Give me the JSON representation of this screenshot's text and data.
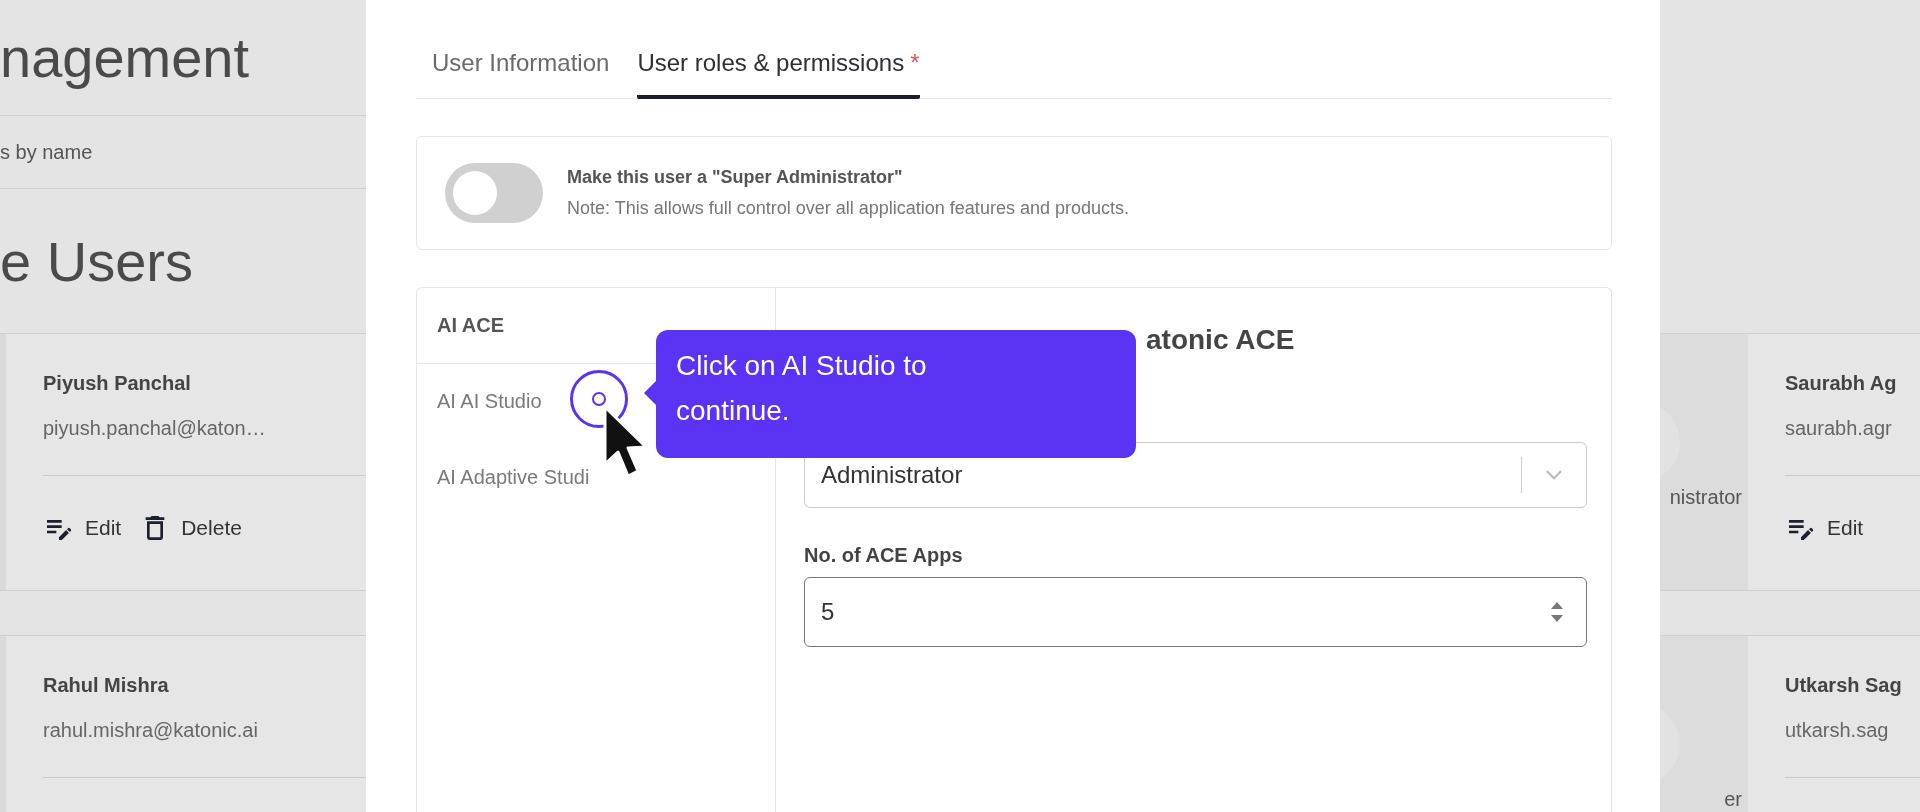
{
  "background": {
    "page_title": "nagement",
    "search_placeholder": "s by name",
    "section_title": "e Users",
    "left_cards": [
      {
        "name": "Piyush Panchal",
        "email": "piyush.panchal@katon…",
        "actions": [
          "Edit",
          "Delete"
        ]
      },
      {
        "name": "Rahul Mishra",
        "email": "rahul.mishra@katonic.ai"
      }
    ],
    "right_cards": [
      {
        "role": "nistrator",
        "name": "Saurabh Ag",
        "email": "saurabh.agr",
        "actions": [
          "Edit"
        ]
      },
      {
        "role": "er",
        "name": "Utkarsh Sag",
        "email": "utkarsh.sag"
      }
    ]
  },
  "modal": {
    "tabs": [
      {
        "label": "User Information",
        "selected": false
      },
      {
        "label": "User roles & permissions",
        "required_mark": "*",
        "selected": true
      }
    ],
    "super_admin": {
      "on": false,
      "title": "Make this user a \"Super Administrator\"",
      "note": "Note: This allows full control over all application features and products."
    },
    "products": [
      {
        "label": "AI ACE",
        "selected": true
      },
      {
        "label": "AI AI Studio",
        "selected": false
      },
      {
        "label": "AI Adaptive Studi",
        "selected": false
      }
    ],
    "product_title": "atonic ACE",
    "role_select": {
      "value": "Administrator"
    },
    "apps_field": {
      "label": "No. of ACE Apps",
      "value": "5"
    }
  },
  "tooltip": {
    "text": "Click on AI Studio to continue."
  }
}
